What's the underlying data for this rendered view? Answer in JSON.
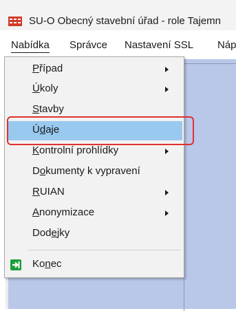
{
  "window": {
    "title": "SU-O  Obecný stavební úřad - role Tajemn"
  },
  "menubar": {
    "items": [
      {
        "label": "Nabídka",
        "mnemonic": "N"
      },
      {
        "label": "Správce",
        "mnemonic": "S"
      },
      {
        "label": "Nastavení SSL",
        "mnemonic": "a"
      },
      {
        "label": "Nápo",
        "mnemonic": "p"
      }
    ]
  },
  "dropdown": {
    "items": [
      {
        "pre": "",
        "mn": "P",
        "post": "řípad",
        "submenu": true
      },
      {
        "pre": "",
        "mn": "Ú",
        "post": "koly",
        "submenu": true
      },
      {
        "pre": "",
        "mn": "S",
        "post": "tavby",
        "submenu": false
      },
      {
        "pre": "Ú",
        "mn": "d",
        "post": "aje",
        "submenu": false,
        "selected": true
      },
      {
        "pre": "",
        "mn": "K",
        "post": "ontrolní prohlídky",
        "submenu": true
      },
      {
        "pre": "D",
        "mn": "o",
        "post": "kumenty k vypravení",
        "submenu": false
      },
      {
        "pre": "",
        "mn": "R",
        "post": "UIAN",
        "submenu": true
      },
      {
        "pre": "",
        "mn": "A",
        "post": "nonymizace",
        "submenu": true
      },
      {
        "pre": "Dod",
        "mn": "e",
        "post": "jky",
        "submenu": false
      },
      {
        "pre": "Ko",
        "mn": "n",
        "post": "ec",
        "submenu": false,
        "icon": "exit-icon"
      }
    ]
  },
  "colors": {
    "highlight": "#99c9ef",
    "annotation_ring": "#e03030",
    "client_bg": "#b9c7e8",
    "exit_icon": "#1f9e3a"
  }
}
